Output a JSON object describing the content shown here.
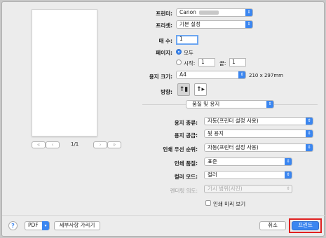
{
  "printer": {
    "label": "프린터:",
    "value": "Canon"
  },
  "presets": {
    "label": "프리셋:",
    "value": "기본 설정"
  },
  "copies": {
    "label": "매 수:",
    "value": "1"
  },
  "pages": {
    "label": "페이지:",
    "all_label": "모두",
    "from_label": "시작:",
    "from_value": "1",
    "to_label": "끝:",
    "to_value": "1"
  },
  "paper_size": {
    "label": "용지 크기:",
    "value": "A4",
    "dimensions": "210 x 297mm"
  },
  "orientation": {
    "label": "방향:"
  },
  "section_menu": {
    "value": "품질 및 용지"
  },
  "settings": [
    {
      "label": "용지 종류:",
      "value": "자동(프린터 설정 사용)"
    },
    {
      "label": "용지 공급:",
      "value": "뒷 용지"
    },
    {
      "label": "인쇄 우선 순위:",
      "value": "자동(프린터 설정 사용)"
    },
    {
      "label": "인쇄 품질:",
      "value": "표준"
    },
    {
      "label": "컬러 모드:",
      "value": "컬러"
    },
    {
      "label": "렌더링 의도:",
      "value": "가시 범위(사진)"
    }
  ],
  "preview_checkbox": {
    "label": "인쇄 미리 보기",
    "checked": false
  },
  "preview_nav": {
    "page_indicator": "1/1"
  },
  "footer": {
    "help": "?",
    "pdf": "PDF",
    "details": "세부사항 가리기",
    "cancel": "취소",
    "print": "프린트"
  },
  "colors": {
    "accent": "#3b86f0",
    "highlight": "#e02020"
  }
}
